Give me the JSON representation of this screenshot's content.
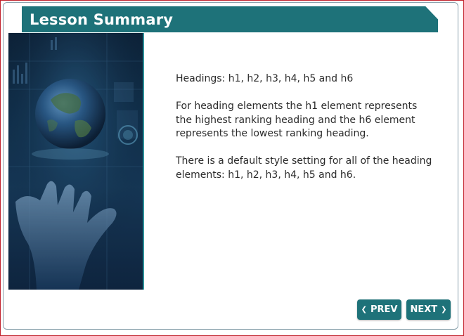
{
  "header": {
    "title": "Lesson Summary"
  },
  "content": {
    "paragraphs": [
      "Headings: h1, h2, h3, h4, h5 and h6",
      "For heading elements the h1 element represents the highest ranking heading and the h6 element represents the lowest ranking heading.",
      "There is a default style setting for all of the heading elements: h1, h2, h3, h4, h5 and h6."
    ]
  },
  "nav": {
    "prev_label": "PREV",
    "next_label": "NEXT",
    "prev_icon": "chevron-left-icon",
    "next_icon": "chevron-right-icon"
  },
  "colors": {
    "accent": "#1e7279",
    "border": "#c0202a"
  }
}
